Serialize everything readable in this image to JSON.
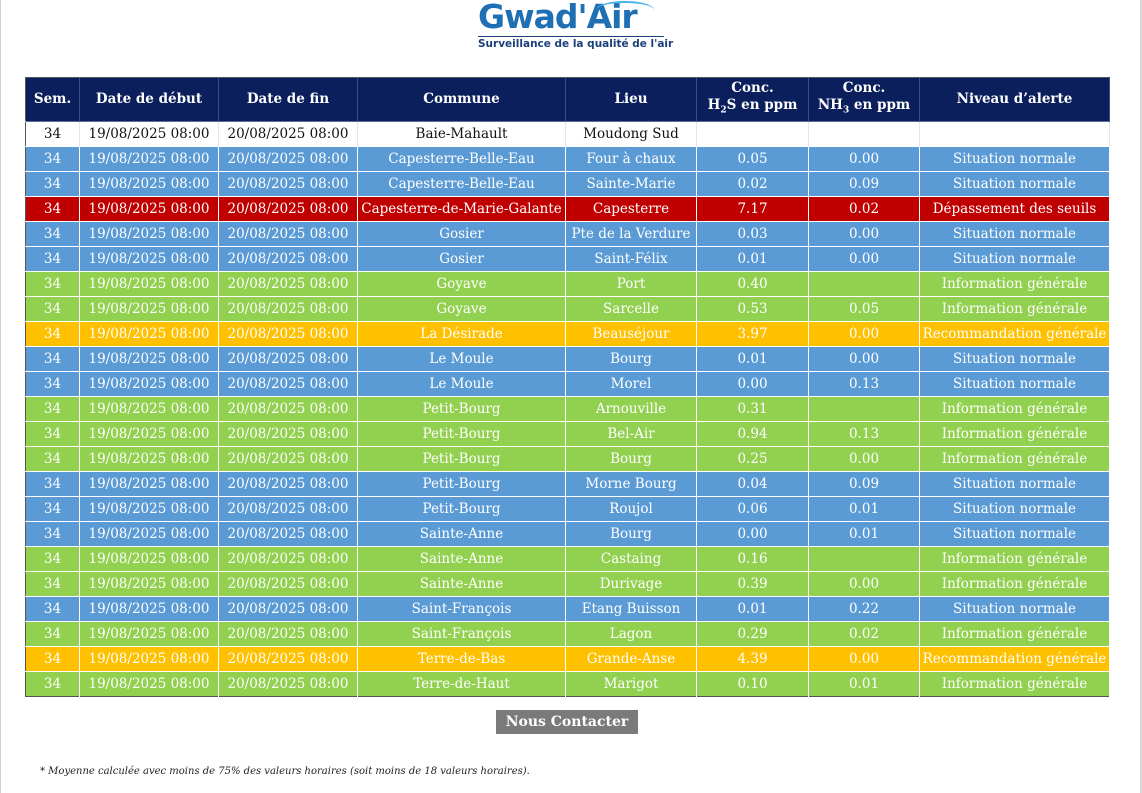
{
  "logo": {
    "name": "Gwad'Air",
    "tagline": "Surveillance de la qualité de l'air",
    "color": "#1f6fb5"
  },
  "colors": {
    "header": "#0b1f5c",
    "normal": "#5b9bd5",
    "info": "#92d050",
    "recommandation": "#ffc000",
    "depassement": "#c00000"
  },
  "table": {
    "headers": {
      "sem": "Sem.",
      "date_debut": "Date de début",
      "date_fin": "Date de fin",
      "commune": "Commune",
      "lieu": "Lieu",
      "h2s_top": "Conc.",
      "h2s_bottom_pre": "H",
      "h2s_bottom_sub": "2",
      "h2s_bottom_post": "S en ppm",
      "nh3_top": "Conc.",
      "nh3_bottom_pre": "NH",
      "nh3_bottom_sub": "3",
      "nh3_bottom_post": " en ppm",
      "niveau": "Niveau d’alerte"
    },
    "rows": [
      {
        "status": "white",
        "sem": "34",
        "debut": "19/08/2025 08:00",
        "fin": "20/08/2025 08:00",
        "commune": "Baie-Mahault",
        "lieu": "Moudong Sud",
        "h2s": "",
        "nh3": "",
        "niveau": ""
      },
      {
        "status": "blue",
        "sem": "34",
        "debut": "19/08/2025 08:00",
        "fin": "20/08/2025 08:00",
        "commune": "Capesterre-Belle-Eau",
        "lieu": "Four à chaux",
        "h2s": "0.05",
        "nh3": "0.00",
        "niveau": "Situation normale"
      },
      {
        "status": "blue",
        "sem": "34",
        "debut": "19/08/2025 08:00",
        "fin": "20/08/2025 08:00",
        "commune": "Capesterre-Belle-Eau",
        "lieu": "Sainte-Marie",
        "h2s": "0.02",
        "nh3": "0.09",
        "niveau": "Situation normale"
      },
      {
        "status": "red",
        "sem": "34",
        "debut": "19/08/2025 08:00",
        "fin": "20/08/2025 08:00",
        "commune": "Capesterre-de-Marie-Galante",
        "lieu": "Capesterre",
        "h2s": "7.17",
        "nh3": "0.02",
        "niveau": "Dépassement des seuils"
      },
      {
        "status": "blue",
        "sem": "34",
        "debut": "19/08/2025 08:00",
        "fin": "20/08/2025 08:00",
        "commune": "Gosier",
        "lieu": "Pte de la Verdure",
        "h2s": "0.03",
        "nh3": "0.00",
        "niveau": "Situation normale"
      },
      {
        "status": "blue",
        "sem": "34",
        "debut": "19/08/2025 08:00",
        "fin": "20/08/2025 08:00",
        "commune": "Gosier",
        "lieu": "Saint-Félix",
        "h2s": "0.01",
        "nh3": "0.00",
        "niveau": "Situation normale"
      },
      {
        "status": "green",
        "sem": "34",
        "debut": "19/08/2025 08:00",
        "fin": "20/08/2025 08:00",
        "commune": "Goyave",
        "lieu": "Port",
        "h2s": "0.40",
        "nh3": "",
        "niveau": "Information générale"
      },
      {
        "status": "green",
        "sem": "34",
        "debut": "19/08/2025 08:00",
        "fin": "20/08/2025 08:00",
        "commune": "Goyave",
        "lieu": "Sarcelle",
        "h2s": "0.53",
        "nh3": "0.05",
        "niveau": "Information générale"
      },
      {
        "status": "orange",
        "sem": "34",
        "debut": "19/08/2025 08:00",
        "fin": "20/08/2025 08:00",
        "commune": "La Désirade",
        "lieu": "Beauséjour",
        "h2s": "3.97",
        "nh3": "0.00",
        "niveau": "Recommandation générale"
      },
      {
        "status": "blue",
        "sem": "34",
        "debut": "19/08/2025 08:00",
        "fin": "20/08/2025 08:00",
        "commune": "Le Moule",
        "lieu": "Bourg",
        "h2s": "0.01",
        "nh3": "0.00",
        "niveau": "Situation normale"
      },
      {
        "status": "blue",
        "sem": "34",
        "debut": "19/08/2025 08:00",
        "fin": "20/08/2025 08:00",
        "commune": "Le Moule",
        "lieu": "Morel",
        "h2s": "0.00",
        "nh3": "0.13",
        "niveau": "Situation normale"
      },
      {
        "status": "green",
        "sem": "34",
        "debut": "19/08/2025 08:00",
        "fin": "20/08/2025 08:00",
        "commune": "Petit-Bourg",
        "lieu": "Arnouville",
        "h2s": "0.31",
        "nh3": "",
        "niveau": "Information générale"
      },
      {
        "status": "green",
        "sem": "34",
        "debut": "19/08/2025 08:00",
        "fin": "20/08/2025 08:00",
        "commune": "Petit-Bourg",
        "lieu": "Bel-Air",
        "h2s": "0.94",
        "nh3": "0.13",
        "niveau": "Information générale"
      },
      {
        "status": "green",
        "sem": "34",
        "debut": "19/08/2025 08:00",
        "fin": "20/08/2025 08:00",
        "commune": "Petit-Bourg",
        "lieu": "Bourg",
        "h2s": "0.25",
        "nh3": "0.00",
        "niveau": "Information générale"
      },
      {
        "status": "blue",
        "sem": "34",
        "debut": "19/08/2025 08:00",
        "fin": "20/08/2025 08:00",
        "commune": "Petit-Bourg",
        "lieu": "Morne Bourg",
        "h2s": "0.04",
        "nh3": "0.09",
        "niveau": "Situation normale"
      },
      {
        "status": "blue",
        "sem": "34",
        "debut": "19/08/2025 08:00",
        "fin": "20/08/2025 08:00",
        "commune": "Petit-Bourg",
        "lieu": "Roujol",
        "h2s": "0.06",
        "nh3": "0.01",
        "niveau": "Situation normale"
      },
      {
        "status": "blue",
        "sem": "34",
        "debut": "19/08/2025 08:00",
        "fin": "20/08/2025 08:00",
        "commune": "Sainte-Anne",
        "lieu": "Bourg",
        "h2s": "0.00",
        "nh3": "0.01",
        "niveau": "Situation normale"
      },
      {
        "status": "green",
        "sem": "34",
        "debut": "19/08/2025 08:00",
        "fin": "20/08/2025 08:00",
        "commune": "Sainte-Anne",
        "lieu": "Castaing",
        "h2s": "0.16",
        "nh3": "",
        "niveau": "Information générale"
      },
      {
        "status": "green",
        "sem": "34",
        "debut": "19/08/2025 08:00",
        "fin": "20/08/2025 08:00",
        "commune": "Sainte-Anne",
        "lieu": "Durivage",
        "h2s": "0.39",
        "nh3": "0.00",
        "niveau": "Information générale"
      },
      {
        "status": "blue",
        "sem": "34",
        "debut": "19/08/2025 08:00",
        "fin": "20/08/2025 08:00",
        "commune": "Saint-François",
        "lieu": "Etang Buisson",
        "h2s": "0.01",
        "nh3": "0.22",
        "niveau": "Situation normale"
      },
      {
        "status": "green",
        "sem": "34",
        "debut": "19/08/2025 08:00",
        "fin": "20/08/2025 08:00",
        "commune": "Saint-François",
        "lieu": "Lagon",
        "h2s": "0.29",
        "nh3": "0.02",
        "niveau": "Information générale"
      },
      {
        "status": "orange",
        "sem": "34",
        "debut": "19/08/2025 08:00",
        "fin": "20/08/2025 08:00",
        "commune": "Terre-de-Bas",
        "lieu": "Grande-Anse",
        "h2s": "4.39",
        "nh3": "0.00",
        "niveau": "Recommandation générale"
      },
      {
        "status": "green",
        "sem": "34",
        "debut": "19/08/2025 08:00",
        "fin": "20/08/2025 08:00",
        "commune": "Terre-de-Haut",
        "lieu": "Marigot",
        "h2s": "0.10",
        "nh3": "0.01",
        "niveau": "Information générale"
      }
    ]
  },
  "contact_button": "Nous Contacter",
  "footnote": "* Moyenne calculée avec moins de 75% des valeurs horaires (soit moins de 18 valeurs horaires)."
}
